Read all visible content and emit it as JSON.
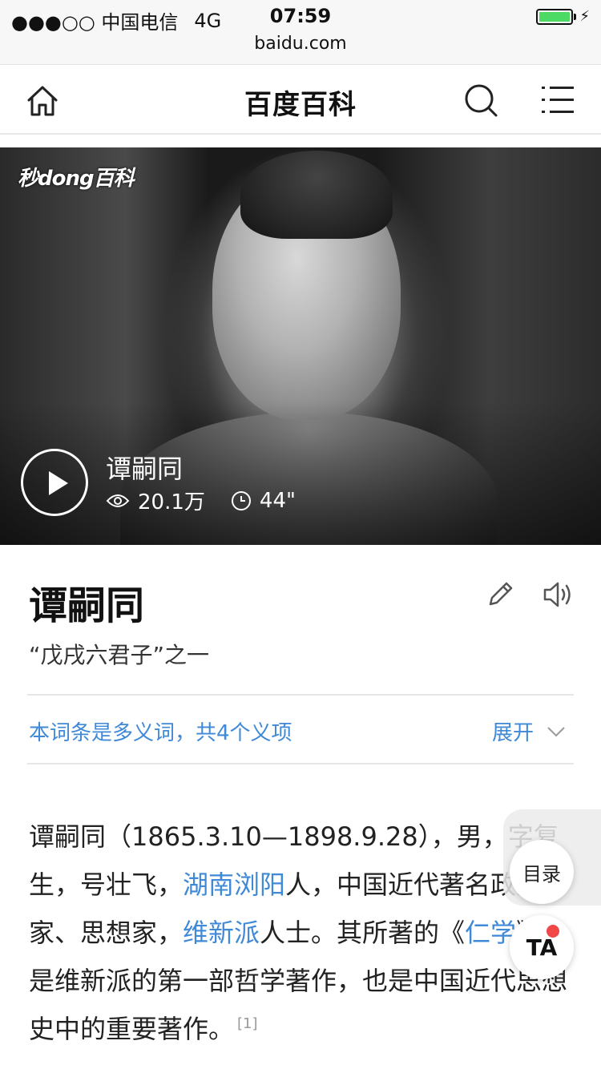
{
  "status_bar": {
    "carrier": "●●●○○ 中国电信",
    "network": "4G",
    "time": "07:59",
    "url": "baidu.com",
    "battery_color": "#4cd964"
  },
  "nav": {
    "title": "百度百科",
    "icons": [
      "home-icon",
      "search-icon",
      "menu-icon"
    ]
  },
  "video": {
    "logo": "秒dong百科",
    "title": "谭嗣同",
    "views": "20.1万",
    "duration": "44\""
  },
  "article": {
    "title": "谭嗣同",
    "subtitle": "“戊戌六君子”之一",
    "polysemy_note": "本词条是多义词，共4个义项",
    "expand_label": "展开",
    "paragraph": {
      "t1": "谭嗣同（1865.3.10—1898.9.28），男，字复生，号壮飞，",
      "link1": "湖南浏阳",
      "t2": "人，中国近代著名政治家、思想家，",
      "link2": "维新派",
      "t3": "人士。其所著的《",
      "link3": "仁学",
      "t4": "》，是维新派的第一部哲学著作，也是中国近代思想史中的重要著作。",
      "ref": "[1]"
    },
    "link_color": "#3f89d7"
  },
  "floating": {
    "toc_label": "目录",
    "ta_label": "TA",
    "badge_color": "#f04848"
  }
}
